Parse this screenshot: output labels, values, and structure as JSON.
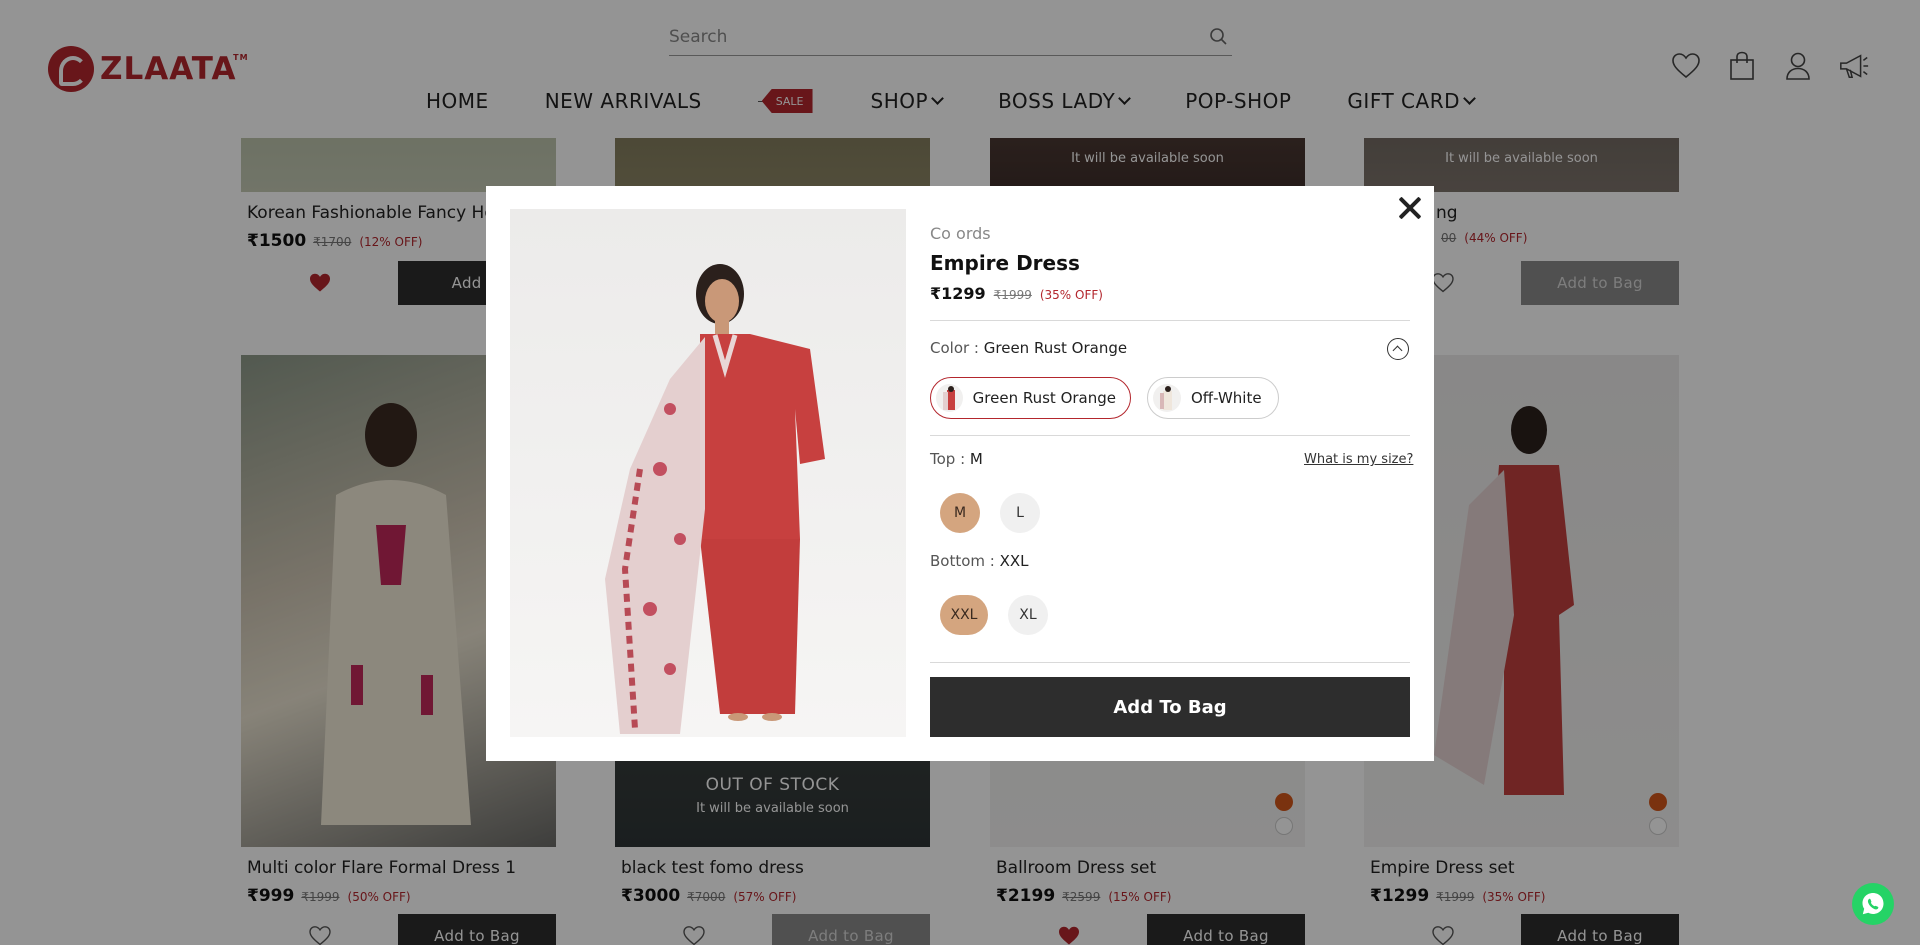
{
  "header": {
    "brand": "ZLAATA",
    "trademark": "TM",
    "search_placeholder": "Search",
    "nav": {
      "home": "HOME",
      "new_arrivals": "NEW ARRIVALS",
      "sale_tag": "SALE",
      "shop": "SHOP",
      "boss_lady": "BOSS LADY",
      "pop_shop": "POP-SHOP",
      "gift_card": "GIFT CARD"
    },
    "icons": [
      "heart-icon",
      "bag-icon",
      "user-icon",
      "megaphone-icon"
    ]
  },
  "products": {
    "top_row": [
      {
        "name": "Korean Fashionable Fancy Ho",
        "price": "₹1500",
        "mrp": "₹1700",
        "off": "(12% OFF)",
        "add_label": "Add to",
        "wishlisted": true
      },
      {
        "name": "",
        "price": "",
        "mrp": "",
        "off": "",
        "add_label": "",
        "wishlisted": false
      },
      {
        "availability": "It will be available soon"
      },
      {
        "name": "ng",
        "price": "",
        "mrp": "00",
        "off": "(44% OFF)",
        "add_label": "Add to Bag",
        "availability": "It will be available soon",
        "wishlisted": false
      }
    ],
    "bottom_row": [
      {
        "name": "Multi color Flare Formal Dress 1",
        "price": "₹999",
        "mrp": "₹1999",
        "off": "(50% OFF)",
        "add_label": "Add to Bag",
        "wishlisted": false
      },
      {
        "name": "black test fomo dress",
        "price": "₹3000",
        "mrp": "₹7000",
        "off": "(57% OFF)",
        "add_label": "Add to Bag",
        "out_of_stock": "OUT OF STOCK",
        "availability": "It will be available soon",
        "wishlisted": false
      },
      {
        "name": "Ballroom Dress set",
        "price": "₹2199",
        "mrp": "₹2599",
        "off": "(15% OFF)",
        "add_label": "Add to Bag",
        "wishlisted": true
      },
      {
        "name": "Empire Dress set",
        "price": "₹1299",
        "mrp": "₹1999",
        "off": "(35% OFF)",
        "add_label": "Add to Bag",
        "wishlisted": false
      }
    ]
  },
  "modal": {
    "category": "Co ords",
    "title": "Empire Dress",
    "price": "₹1299",
    "mrp": "₹1999",
    "off": "(35% OFF)",
    "color_label": "Color : ",
    "color_value": "Green Rust Orange",
    "color_options": [
      "Green Rust Orange",
      "Off-White"
    ],
    "top_label": "Top : ",
    "top_value": "M",
    "size_guide": "What is my size?",
    "top_sizes": [
      "M",
      "L"
    ],
    "bottom_label": "Bottom : ",
    "bottom_value": "XXL",
    "bottom_sizes": [
      "XXL",
      "XL"
    ],
    "add_to_bag": "Add To Bag"
  },
  "colors": {
    "brand_red": "#b3262d",
    "dark_button": "#2d2d2d",
    "selected_size": "#d4a57f",
    "whatsapp": "#25d366"
  }
}
